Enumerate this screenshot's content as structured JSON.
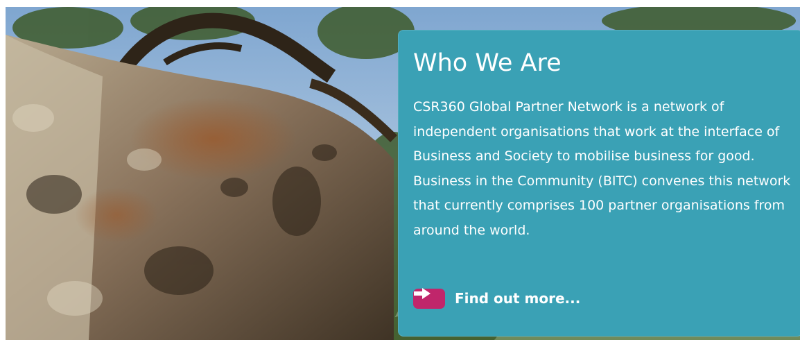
{
  "hero": {
    "image_description": "tree-bark-photo",
    "colors": {
      "panel": "#3aa1b5",
      "cta_icon": "#c0266b",
      "text": "#ffffff"
    }
  },
  "panel": {
    "title": "Who We Are",
    "body": "CSR360 Global Partner Network is a network of independent organisations that work at the interface of Business and Society to mobilise business for good. Business in the Community (BITC) convenes this network that currently comprises 100 partner organisations from around the world.",
    "cta": {
      "label": "Find out more...",
      "icon": "arrow-right-icon"
    }
  }
}
